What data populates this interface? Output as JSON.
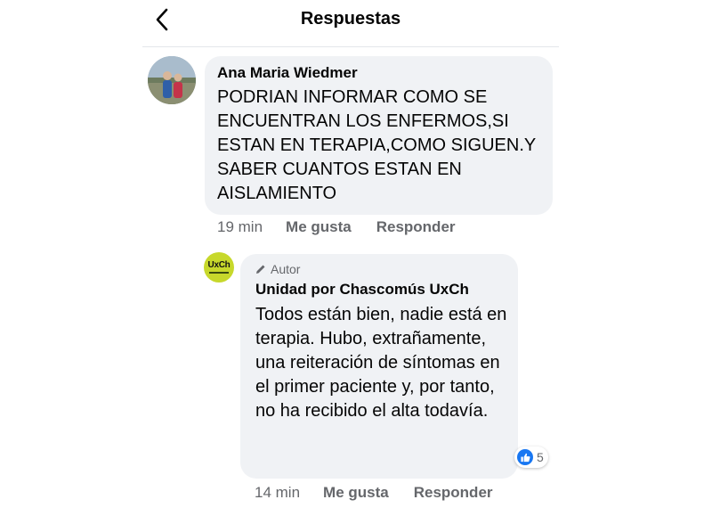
{
  "header": {
    "title": "Respuestas",
    "back_icon": "chevron-left-icon"
  },
  "comments": [
    {
      "author": "Ana Maria Wiedmer",
      "avatar": "profile-photo",
      "text": "PODRIAN INFORMAR COMO SE ENCUENTRAN LOS ENFERMOS,SI ESTAN EN TERAPIA,COMO SIGUEN.Y SABER CUANTOS ESTAN EN AISLAMIENTO",
      "time": "19 min",
      "like_label": "Me gusta",
      "reply_label": "Responder"
    },
    {
      "author_badge": "Autor",
      "author_badge_icon": "pencil-icon",
      "author": "Unidad por Chascomús UxCh",
      "avatar_text": "UxCh",
      "text": "Todos están bien, nadie está en terapia. Hubo, extrañamente, una reiteración de síntomas en el primer paciente y, por tanto, no ha recibido el alta todavía.",
      "time": "14 min",
      "like_label": "Me gusta",
      "reply_label": "Responder",
      "reaction_icon": "like-reaction-icon",
      "reaction_count": "5"
    }
  ],
  "colors": {
    "bubble": "#f0f2f5",
    "secondary_text": "#65676b",
    "like_blue": "#1877f2",
    "uxch_logo_bg": "#c7d82b"
  }
}
